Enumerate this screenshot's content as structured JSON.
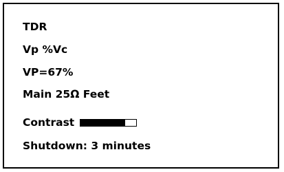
{
  "screen": {
    "mode": "TDR",
    "vp_line": "Vp %Vc",
    "vp_value": "VP=67%",
    "cable_line": "Main 25Ω Feet",
    "contrast_label": "Contrast",
    "contrast_level": 0.8,
    "shutdown_line": "Shutdown: 3 minutes"
  },
  "colors": {
    "text": "#000000",
    "background": "#ffffff",
    "bar_fill": "#000000"
  }
}
